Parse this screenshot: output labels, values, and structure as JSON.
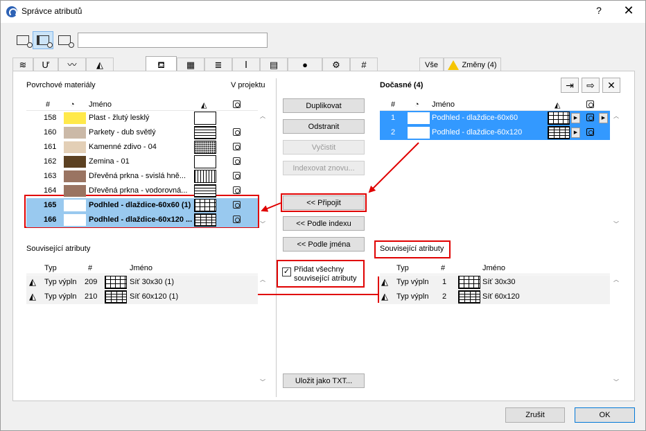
{
  "window": {
    "title": "Správce atributů",
    "help": "?",
    "close": "✕"
  },
  "tabs": {
    "all_label": "Vše",
    "changes_label": "Změny (4)"
  },
  "left": {
    "header": "Povrchové materiály",
    "in_project_header": "V projektu",
    "columns": {
      "num": "#",
      "name": "Jméno"
    },
    "rows": [
      {
        "num": "158",
        "color": "#ffe94a",
        "name": "Plast - žlutý lesklý",
        "pattern": "none",
        "proj": false
      },
      {
        "num": "160",
        "color": "#cbb9a7",
        "name": "Parkety - dub světlý",
        "pattern": "h",
        "proj": true
      },
      {
        "num": "161",
        "color": "#e3cfb6",
        "name": "Kamenné zdivo - 04",
        "pattern": "dot",
        "proj": true
      },
      {
        "num": "162",
        "color": "#5c4122",
        "name": "Zemina - 01",
        "pattern": "none",
        "proj": true
      },
      {
        "num": "163",
        "color": "#9a7462",
        "name": "Dřevěná prkna - svislá hně...",
        "pattern": "v",
        "proj": true
      },
      {
        "num": "164",
        "color": "#9a7462",
        "name": "Dřevěná prkna - vodorovná...",
        "pattern": "h",
        "proj": true
      },
      {
        "num": "165",
        "color": "#ffffff",
        "name": "Podhled - dlaždice-60x60 (1)",
        "pattern": "grid",
        "proj": true
      },
      {
        "num": "166",
        "color": "#ffffff",
        "name": "Podhled - dlaždice-60x120 ...",
        "pattern": "grid2",
        "proj": true
      }
    ]
  },
  "left_related": {
    "header": "Související atributy",
    "columns": {
      "type": "Typ",
      "num": "#",
      "name": "Jméno"
    },
    "rows": [
      {
        "type": "Typ výpln",
        "num": "209",
        "name": "Síť 30x30 (1)"
      },
      {
        "type": "Typ výpln",
        "num": "210",
        "name": "Síť 60x120 (1)"
      }
    ]
  },
  "middle": {
    "duplicate": "Duplikovat",
    "remove": "Odstranit",
    "clear": "Vyčistit",
    "reindex": "Indexovat znovu...",
    "append": "<< Připojit",
    "by_index": "<< Podle indexu",
    "by_name": "<< Podle jména",
    "add_related": "Přidat všechny související atributy",
    "save_txt": "Uložit jako TXT..."
  },
  "right": {
    "header": "Dočasné (4)",
    "columns": {
      "num": "#",
      "name": "Jméno"
    },
    "rows": [
      {
        "num": "1",
        "name": "Podhled - dlaždice-60x60"
      },
      {
        "num": "2",
        "name": "Podhled - dlaždice-60x120"
      }
    ]
  },
  "right_related": {
    "header": "Související atributy",
    "columns": {
      "type": "Typ",
      "num": "#",
      "name": "Jméno"
    },
    "rows": [
      {
        "type": "Typ výpln",
        "num": "1",
        "name": "Síť 30x30"
      },
      {
        "type": "Typ výpln",
        "num": "2",
        "name": "Síť 60x120"
      }
    ]
  },
  "footer": {
    "cancel": "Zrušit",
    "ok": "OK"
  },
  "colors": {
    "selection": "#99c9ef",
    "selection_blue": "#3399ff",
    "highlight_red": "#e00000"
  }
}
